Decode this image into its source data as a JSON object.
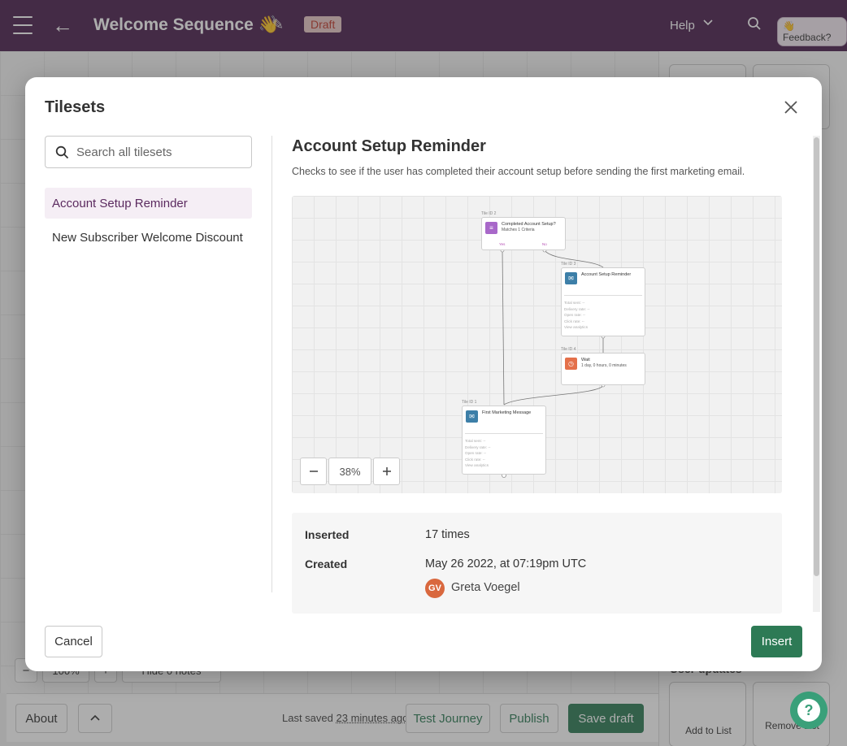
{
  "app": {
    "title": "Welcome Sequence",
    "title_emoji": "👋",
    "status_badge": "Draft",
    "help_label": "Help",
    "feedback_label": "👋 Feedback?"
  },
  "background": {
    "zoom_value": "100%",
    "hide_notes_label": "Hide 0 notes",
    "about_label": "About",
    "last_saved_prefix": "Last saved",
    "last_saved_time": "23 minutes ago",
    "test_journey_label": "Test Journey",
    "publish_label": "Publish",
    "save_draft_label": "Save draft",
    "user_updates_label": "User updates",
    "add_to_list_label": "Add to List",
    "remove_list_label": "Remove List"
  },
  "modal": {
    "title": "Tilesets",
    "search_placeholder": "Search all tilesets",
    "tilesets": [
      {
        "label": "Account Setup Reminder"
      },
      {
        "label": "New Subscriber Welcome Discount"
      }
    ],
    "selected": {
      "title": "Account Setup Reminder",
      "description": "Checks to see if the user has completed their account setup before sending the first marketing email.",
      "zoom": "38%",
      "inserted_label": "Inserted",
      "inserted_value": "17 times",
      "created_label": "Created",
      "created_value": "May 26 2022, at 07:19pm UTC",
      "author_initials": "GV",
      "author_name": "Greta Voegel"
    },
    "cancel_label": "Cancel",
    "insert_label": "Insert"
  },
  "preview_nodes": {
    "n2": {
      "tag": "Tile ID 2",
      "name": "Completed Account Setup?",
      "sub": "Matches 1 Criteria",
      "yes": "Yes",
      "no": "No"
    },
    "n3": {
      "tag": "Tile ID 3",
      "name": "Account Setup Reminder",
      "stats": [
        "Total sent: --",
        "Delivery rate: --",
        "Open rate: --",
        "Click rate: --",
        "View analytics"
      ]
    },
    "n4": {
      "tag": "Tile ID 4",
      "name": "Wait",
      "sub": "1 day, 0 hours, 0 minutes"
    },
    "n1": {
      "tag": "Tile ID 1",
      "name": "First Marketing Message",
      "stats": [
        "Total sent: --",
        "Delivery rate: --",
        "Open rate: --",
        "Click rate: --",
        "View analytics"
      ]
    }
  },
  "colors": {
    "header": "#4a1f4f",
    "accent_green": "#2d7a55",
    "selected_bg": "#f5eef5",
    "avatar": "#d9683e"
  },
  "icons": [
    "menu-icon",
    "back-arrow-icon",
    "pencil-icon",
    "chevron-down-icon",
    "search-icon",
    "close-icon",
    "minus-icon",
    "plus-icon",
    "help-icon"
  ]
}
